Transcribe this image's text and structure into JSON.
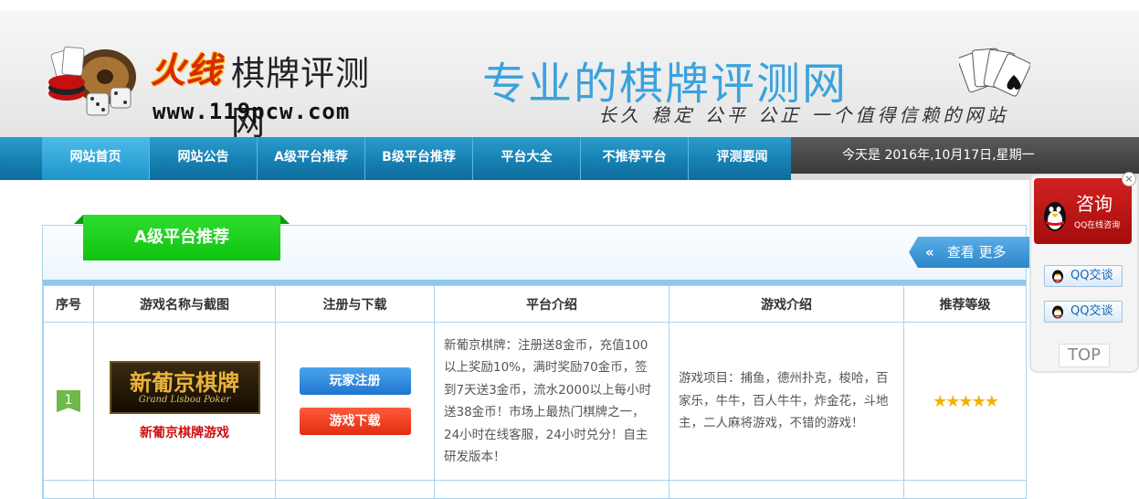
{
  "header": {
    "logo_fire": "火线",
    "logo_rest": "棋牌评测网",
    "logo_url": "www.119pcw.com",
    "slogan_main": "专业的棋牌评测网",
    "slogan_sub": "长久 稳定 公平 公正  一个值得信赖的网站",
    "colors": {
      "slogan": "#3aa3dd",
      "logo_fire": "#d62a0a"
    }
  },
  "nav": {
    "items": [
      {
        "label": "网站首页",
        "active": true
      },
      {
        "label": "网站公告"
      },
      {
        "label": "A级平台推荐"
      },
      {
        "label": "B级平台推荐"
      },
      {
        "label": "平台大全"
      },
      {
        "label": "不推荐平台"
      },
      {
        "label": "评测要闻"
      }
    ],
    "date_text": "今天是 2016年,10月17日,星期一"
  },
  "section": {
    "tab_label": "A级平台推荐",
    "more_label": "查看 更多",
    "more_arrow": "«"
  },
  "table": {
    "headers": [
      "序号",
      "游戏名称与截图",
      "注册与下载",
      "平台介绍",
      "游戏介绍",
      "推荐等级"
    ],
    "rows": [
      {
        "rank": "1",
        "logo_title": "新葡京棋牌",
        "logo_subtitle": "Grand Lisboa Poker",
        "game_name": "新葡京棋牌游戏",
        "register_label": "玩家注册",
        "download_label": "游戏下载",
        "platform_intro": "新葡京棋牌：注册送8金币，充值100以上奖励10%，满时奖励70金币，签到7天送3金币，流水2000以上每小时送38金币！市场上最热门棋牌之一，24小时在线客服，24小时兑分！自主研发版本！",
        "game_intro": "游戏项目：捕鱼，德州扑克，梭哈，百家乐，牛牛，百人牛牛，炸金花，斗地主，二人麻将游戏，不错的游戏！",
        "stars": "★★★★★",
        "rating": 5
      }
    ]
  },
  "qq_widget": {
    "title": "咨询",
    "subtitle": "QQ在线咨询",
    "close": "×",
    "buttons": [
      "QQ交谈",
      "QQ交谈"
    ],
    "top_label": "TOP"
  }
}
